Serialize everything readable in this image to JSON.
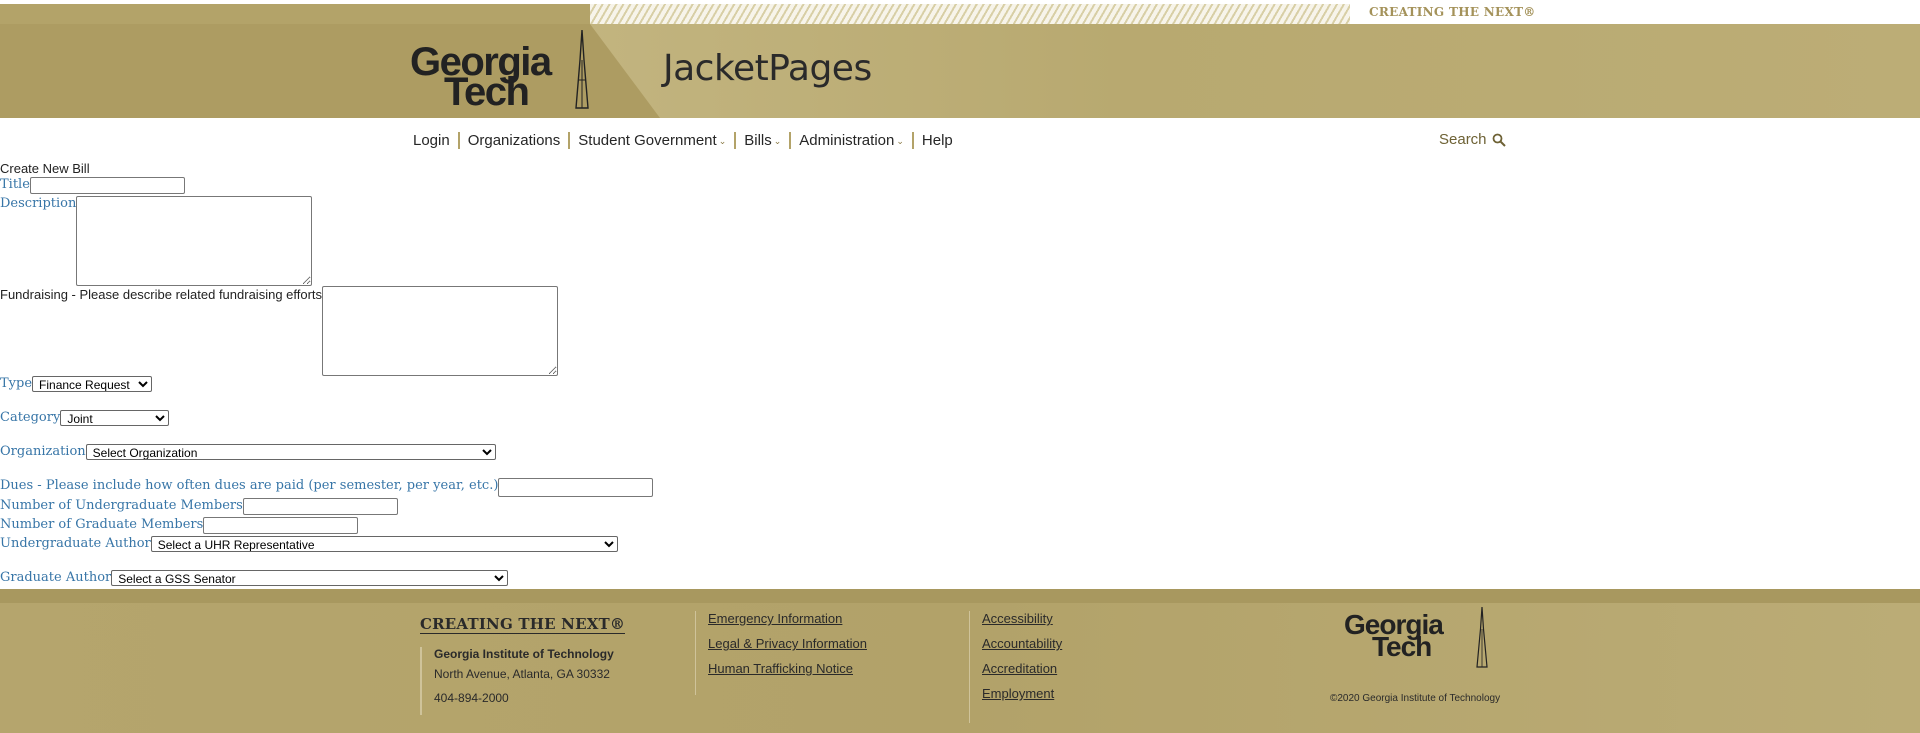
{
  "header": {
    "tagline": "CREATING THE NEXT®",
    "logo_line1": "Georgia",
    "logo_line2": "Tech",
    "app_title": "JacketPages"
  },
  "nav": {
    "items": [
      {
        "label": "Login",
        "dropdown": false
      },
      {
        "label": "Organizations",
        "dropdown": false
      },
      {
        "label": "Student Government",
        "dropdown": true
      },
      {
        "label": "Bills",
        "dropdown": true
      },
      {
        "label": "Administration",
        "dropdown": true
      },
      {
        "label": "Help",
        "dropdown": false
      }
    ],
    "search_label": "Search",
    "search_icon": "search-icon"
  },
  "form": {
    "heading": "Create New Bill",
    "title_label": "Title",
    "title_value": "",
    "description_label": "Description",
    "description_value": "",
    "fundraising_label": "Fundraising - Please describe related fundraising efforts",
    "fundraising_value": "",
    "type_label": "Type",
    "type_selected": "Finance Request",
    "category_label": "Category",
    "category_selected": "Joint",
    "organization_label": "Organization",
    "organization_selected": "Select Organization",
    "dues_label": "Dues - Please include how often dues are paid (per semester, per year, etc.)",
    "dues_value": "",
    "undergrad_members_label": "Number of Undergraduate Members",
    "undergrad_members_value": "",
    "grad_members_label": "Number of Graduate Members",
    "grad_members_value": "",
    "undergrad_author_label": "Undergraduate Author",
    "undergrad_author_selected": "Select a UHR Representative",
    "grad_author_label": "Graduate Author",
    "grad_author_selected": "Select a GSS Senator"
  },
  "footer": {
    "tagline": "CREATING THE NEXT®",
    "institute": "Georgia Institute of Technology",
    "address": "North Avenue, Atlanta, GA 30332",
    "phone": "404-894-2000",
    "links_col1": [
      "Emergency Information",
      "Legal & Privacy Information",
      "Human Trafficking Notice"
    ],
    "links_col2": [
      "Accessibility",
      "Accountability",
      "Accreditation",
      "Employment"
    ],
    "logo_line1": "Georgia",
    "logo_line2": "Tech",
    "copyright": "©2020 Georgia Institute of Technology"
  },
  "colors": {
    "gold": "#b3a369",
    "label_blue": "#3775a7",
    "text_dark": "#222222"
  }
}
